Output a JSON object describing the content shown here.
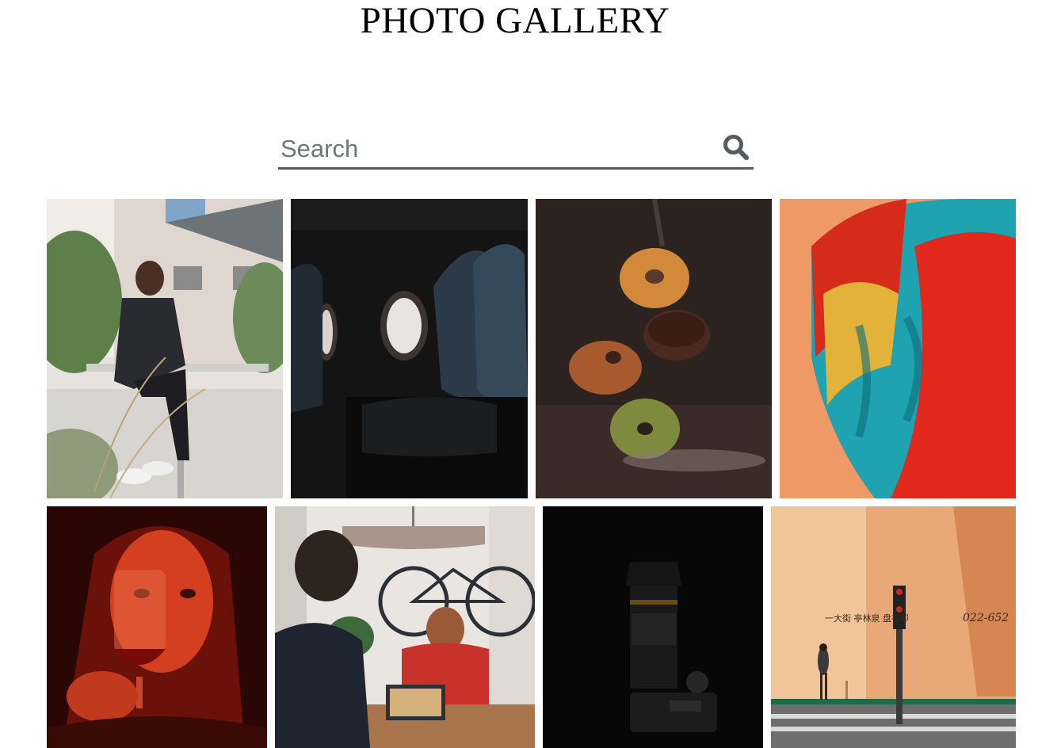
{
  "page": {
    "title": "PHOTO GALLERY"
  },
  "search": {
    "placeholder": "Search",
    "value": "",
    "icon": "search-icon"
  },
  "gallery": {
    "rows": [
      [
        {
          "subject": "businessman-on-phone"
        },
        {
          "subject": "airplane-cabin"
        },
        {
          "subject": "floating-donuts"
        },
        {
          "subject": "macaw-feathers"
        }
      ],
      [
        {
          "subject": "woman-with-wine-glass"
        },
        {
          "subject": "office-meeting-with-bicycle"
        },
        {
          "subject": "camera-with-lens"
        },
        {
          "subject": "street-traffic-light",
          "sign_text": "一大街 亭林泉 盘在即",
          "phone_text": "022-652"
        }
      ]
    ]
  },
  "colors": {
    "search_underline": "#555b5f",
    "search_icon": "#555b5f",
    "placeholder": "#70757a"
  }
}
